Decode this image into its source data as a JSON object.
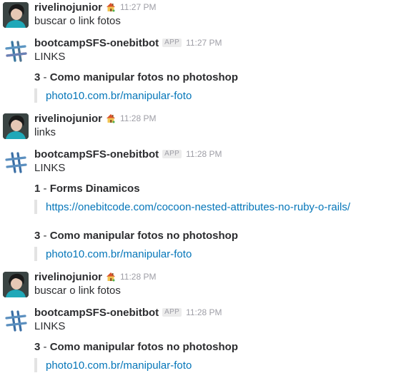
{
  "messages": [
    {
      "sender": "rivelinojunior",
      "is_bot": false,
      "time": "11:27 PM",
      "text": "buscar o link fotos"
    },
    {
      "sender": "bootcampSFS-onebitbot",
      "is_bot": true,
      "app_tag": "APP",
      "time": "11:27 PM",
      "heading": "LINKS",
      "items": [
        {
          "num": "3",
          "sep": " - ",
          "title": "Como manipular fotos no photoshop",
          "url": "photo10.com.br/manipular-foto"
        }
      ]
    },
    {
      "sender": "rivelinojunior",
      "is_bot": false,
      "time": "11:28 PM",
      "text": "links"
    },
    {
      "sender": "bootcampSFS-onebitbot",
      "is_bot": true,
      "app_tag": "APP",
      "time": "11:28 PM",
      "heading": "LINKS",
      "items": [
        {
          "num": "1",
          "sep": " - ",
          "title": "Forms Dinamicos",
          "url": "https://onebitcode.com/cocoon-nested-attributes-no-ruby-o-rails/"
        },
        {
          "num": "3",
          "sep": " - ",
          "title": "Como manipular fotos no photoshop",
          "url": "photo10.com.br/manipular-foto"
        }
      ]
    },
    {
      "sender": "rivelinojunior",
      "is_bot": false,
      "time": "11:28 PM",
      "text": "buscar o link fotos"
    },
    {
      "sender": "bootcampSFS-onebitbot",
      "is_bot": true,
      "app_tag": "APP",
      "time": "11:28 PM",
      "heading": "LINKS",
      "items": [
        {
          "num": "3",
          "sep": " - ",
          "title": "Como manipular fotos no photoshop",
          "url": "photo10.com.br/manipular-foto"
        }
      ]
    }
  ],
  "colors": {
    "link": "#0576b9",
    "text": "#2c2d30",
    "muted": "#9e9ea6",
    "quote_bar": "#e3e3e3"
  },
  "icons": {
    "user_emoji": "house-emoji-icon",
    "bot_avatar": "slack-hash-logo-icon"
  }
}
